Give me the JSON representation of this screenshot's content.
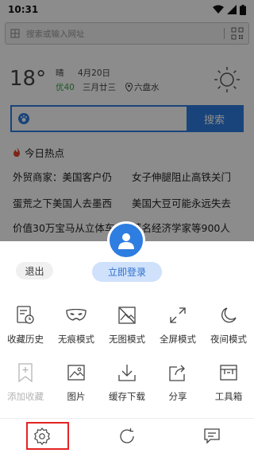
{
  "status_bar": {
    "time": "10:31"
  },
  "address_bar": {
    "placeholder": "搜索或输入网址"
  },
  "weather": {
    "temperature": "18°",
    "condition": "晴",
    "date": "4月20日",
    "aqi": "优40",
    "lunar_date": "三月廿三",
    "location": "六盘水"
  },
  "search": {
    "button_label": "搜索"
  },
  "hot_news": {
    "title": "今日热点",
    "rows": [
      [
        "外贸商家：美国客户仍",
        "女子伸腿阻止高铁关门"
      ],
      [
        "蛋荒之下美国人去墨西",
        "美国大豆可能永远失去"
      ],
      [
        "价值30万宝马从立体车",
        "著名经济学家等900人"
      ]
    ]
  },
  "sheet": {
    "logout_label": "退出",
    "login_label": "立即登录",
    "row1": [
      {
        "label": "收藏历史",
        "icon": "history-icon"
      },
      {
        "label": "无痕模式",
        "icon": "mask-icon"
      },
      {
        "label": "无图模式",
        "icon": "no-image-icon"
      },
      {
        "label": "全屏模式",
        "icon": "fullscreen-icon"
      },
      {
        "label": "夜间模式",
        "icon": "moon-icon"
      }
    ],
    "row2": [
      {
        "label": "添加收藏",
        "icon": "bookmark-add-icon",
        "disabled": true
      },
      {
        "label": "图片",
        "icon": "image-icon"
      },
      {
        "label": "缓存下载",
        "icon": "download-icon"
      },
      {
        "label": "分享",
        "icon": "share-icon"
      },
      {
        "label": "工具箱",
        "icon": "toolbox-icon"
      }
    ]
  },
  "colors": {
    "accent": "#2e7de1",
    "highlight": "#e52222",
    "aqi_green": "#3aa345"
  }
}
